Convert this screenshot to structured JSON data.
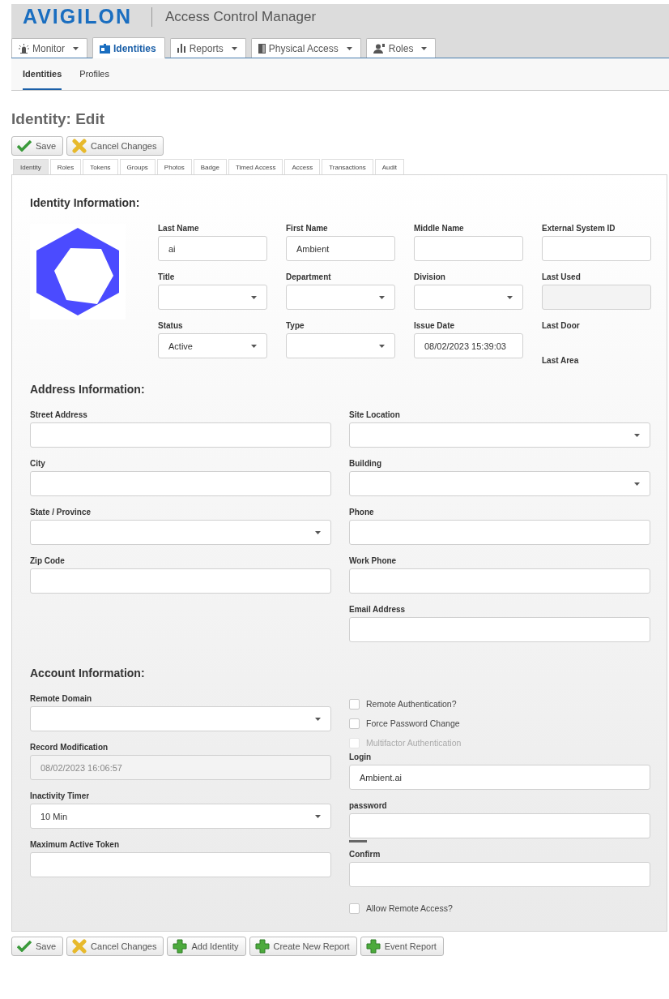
{
  "header": {
    "logo": "AVIGILON",
    "app_title": "Access Control Manager"
  },
  "nav_tabs": [
    {
      "label": "Monitor",
      "selected": false,
      "dropdown": true
    },
    {
      "label": "Identities",
      "selected": true,
      "dropdown": false
    },
    {
      "label": "Reports",
      "selected": false,
      "dropdown": true
    },
    {
      "label": "Physical Access",
      "selected": false,
      "dropdown": true
    },
    {
      "label": "Roles",
      "selected": false,
      "dropdown": true
    }
  ],
  "sub_nav": [
    {
      "label": "Identities",
      "selected": true
    },
    {
      "label": "Profiles",
      "selected": false
    }
  ],
  "page_title": "Identity: Edit",
  "top_buttons": [
    {
      "label": "Save",
      "kind": "save"
    },
    {
      "label": "Cancel Changes",
      "kind": "cancel"
    }
  ],
  "tabs": [
    {
      "label": "Identity",
      "selected": true
    },
    {
      "label": "Roles",
      "selected": false
    },
    {
      "label": "Tokens",
      "selected": false
    },
    {
      "label": "Groups",
      "selected": false
    },
    {
      "label": "Photos",
      "selected": false
    },
    {
      "label": "Badge",
      "selected": false
    },
    {
      "label": "Timed Access",
      "selected": false
    },
    {
      "label": "Access",
      "selected": false
    },
    {
      "label": "Transactions",
      "selected": false
    },
    {
      "label": "Audit",
      "selected": false
    }
  ],
  "identity_section": {
    "heading": "Identity Information:",
    "fields": [
      {
        "label": "Last Name",
        "kind": "text",
        "value": "ai"
      },
      {
        "label": "First Name",
        "kind": "text",
        "value": "Ambient"
      },
      {
        "label": "Middle Name",
        "kind": "text"
      },
      {
        "label": "External System ID",
        "kind": "text"
      },
      {
        "label": "Title",
        "kind": "select"
      },
      {
        "label": "Department",
        "kind": "select"
      },
      {
        "label": "Division",
        "kind": "select"
      },
      {
        "label": "Last Used",
        "kind": "disabled"
      },
      {
        "label": "Status",
        "kind": "select",
        "value": "Active"
      },
      {
        "label": "Type",
        "kind": "select"
      },
      {
        "label": "Issue Date",
        "kind": "text",
        "value": "08/02/2023 15:39:03"
      },
      {
        "label": "Last Door",
        "kind": "none"
      },
      {
        "label": "Last Area",
        "kind": "none"
      }
    ]
  },
  "address_section": {
    "heading": "Address Information:",
    "left_fields": [
      {
        "label": "Street Address",
        "kind": "text"
      },
      {
        "label": "City",
        "kind": "text"
      },
      {
        "label": "State / Province",
        "kind": "select"
      },
      {
        "label": "Zip Code",
        "kind": "text"
      }
    ],
    "right_fields": [
      {
        "label": "Site Location",
        "kind": "select"
      },
      {
        "label": "Building",
        "kind": "select"
      },
      {
        "label": "Phone",
        "kind": "text"
      },
      {
        "label": "Work Phone",
        "kind": "text"
      },
      {
        "label": "Email Address",
        "kind": "text"
      }
    ]
  },
  "account_section": {
    "heading": "Account Information:",
    "left_fields": [
      {
        "label": "Remote Domain",
        "kind": "select"
      },
      {
        "label": "Record Modification",
        "kind": "disabled",
        "value": "08/02/2023 16:06:57"
      },
      {
        "label": "Inactivity Timer",
        "kind": "select",
        "value": "10 Min"
      },
      {
        "label": "Maximum Active Token",
        "kind": "text"
      }
    ],
    "right_items": [
      {
        "kind": "checkbox",
        "label": "Remote Authentication?",
        "checked": false,
        "disabled": false
      },
      {
        "kind": "checkbox",
        "label": "Force Password Change",
        "checked": false,
        "disabled": false
      },
      {
        "kind": "checkbox",
        "label": "Multifactor Authentication",
        "checked": false,
        "disabled": true
      },
      {
        "kind": "text",
        "label": "Login",
        "value": "Ambient.ai"
      },
      {
        "kind": "password",
        "label": "password"
      },
      {
        "kind": "text",
        "label": "Confirm"
      },
      {
        "kind": "checkbox",
        "label": "Allow Remote Access?",
        "checked": false,
        "disabled": false
      }
    ]
  },
  "bottom_buttons": [
    {
      "label": "Save",
      "kind": "save"
    },
    {
      "label": "Cancel Changes",
      "kind": "cancel"
    },
    {
      "label": "Add Identity",
      "kind": "add"
    },
    {
      "label": "Create New Report",
      "kind": "add"
    },
    {
      "label": "Event Report",
      "kind": "add"
    }
  ]
}
